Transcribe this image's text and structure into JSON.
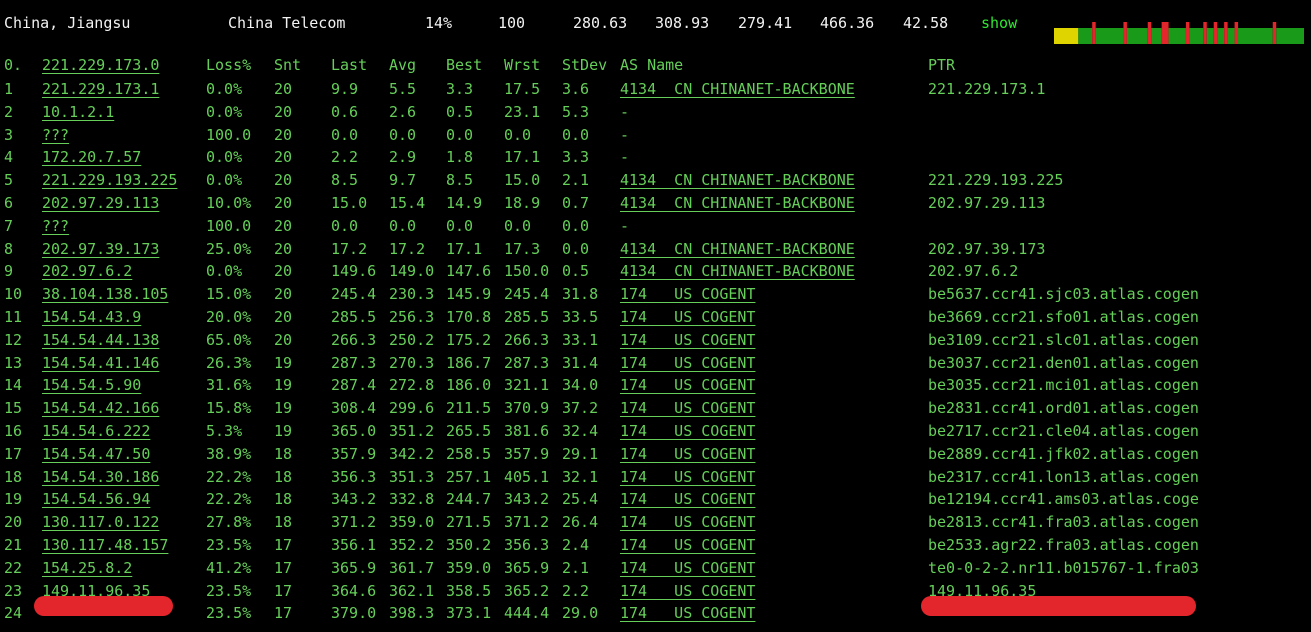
{
  "summary": {
    "location": "China, Jiangsu",
    "isp": "China Telecom",
    "loss": "14%",
    "sent": "100",
    "last": "280.63",
    "avg": "308.93",
    "best": "279.41",
    "worst": "466.36",
    "stdev": "42.58",
    "show_label": "show"
  },
  "colors": {
    "background": "#000000",
    "text": "#65cf59",
    "summary_text": "#f2f2f2",
    "show_link": "#2fe82f",
    "spark_good": "#199a19",
    "spark_warn": "#e0d400",
    "spark_bad": "#e3262b",
    "redaction": "#e3262b"
  },
  "spark_data": [
    {
      "level": "warn",
      "count": 7
    },
    {
      "level": "good",
      "count": 4
    },
    {
      "level": "bad",
      "count": 1
    },
    {
      "level": "good",
      "count": 8
    },
    {
      "level": "bad",
      "count": 1
    },
    {
      "level": "good",
      "count": 6
    },
    {
      "level": "bad",
      "count": 1
    },
    {
      "level": "good",
      "count": 3
    },
    {
      "level": "bad",
      "count": 2
    },
    {
      "level": "good",
      "count": 5
    },
    {
      "level": "bad",
      "count": 1
    },
    {
      "level": "good",
      "count": 4
    },
    {
      "level": "bad",
      "count": 1
    },
    {
      "level": "good",
      "count": 2
    },
    {
      "level": "bad",
      "count": 1
    },
    {
      "level": "good",
      "count": 2
    },
    {
      "level": "bad",
      "count": 1
    },
    {
      "level": "good",
      "count": 2
    },
    {
      "level": "bad",
      "count": 1
    },
    {
      "level": "good",
      "count": 10
    },
    {
      "level": "bad",
      "count": 1
    },
    {
      "level": "good",
      "count": 8
    }
  ],
  "header": {
    "idx": "0.",
    "host": "221.229.173.0",
    "loss": "Loss%",
    "snt": "Snt",
    "last": "Last",
    "avg": "Avg",
    "best": "Best",
    "wrst": "Wrst",
    "stdev": "StDev",
    "as_name": "AS Name",
    "ptr": "PTR"
  },
  "hops": [
    {
      "idx": "1",
      "host": "221.229.173.1",
      "loss": "0.0%",
      "snt": "20",
      "last": "9.9",
      "avg": "5.5",
      "best": "3.3",
      "wrst": "17.5",
      "stdev": "3.6",
      "as": "4134  CN CHINANET-BACKBONE",
      "ptr": "221.229.173.1"
    },
    {
      "idx": "2",
      "host": "10.1.2.1",
      "loss": "0.0%",
      "snt": "20",
      "last": "0.6",
      "avg": "2.6",
      "best": "0.5",
      "wrst": "23.1",
      "stdev": "5.3",
      "as": "-",
      "ptr": ""
    },
    {
      "idx": "3",
      "host": "???",
      "loss": "100.0",
      "snt": "20",
      "last": "0.0",
      "avg": "0.0",
      "best": "0.0",
      "wrst": "0.0",
      "stdev": "0.0",
      "as": "-",
      "ptr": ""
    },
    {
      "idx": "4",
      "host": "172.20.7.57",
      "loss": "0.0%",
      "snt": "20",
      "last": "2.2",
      "avg": "2.9",
      "best": "1.8",
      "wrst": "17.1",
      "stdev": "3.3",
      "as": "-",
      "ptr": ""
    },
    {
      "idx": "5",
      "host": "221.229.193.225",
      "loss": "0.0%",
      "snt": "20",
      "last": "8.5",
      "avg": "9.7",
      "best": "8.5",
      "wrst": "15.0",
      "stdev": "2.1",
      "as": "4134  CN CHINANET-BACKBONE",
      "ptr": "221.229.193.225"
    },
    {
      "idx": "6",
      "host": "202.97.29.113",
      "loss": "10.0%",
      "snt": "20",
      "last": "15.0",
      "avg": "15.4",
      "best": "14.9",
      "wrst": "18.9",
      "stdev": "0.7",
      "as": "4134  CN CHINANET-BACKBONE",
      "ptr": "202.97.29.113"
    },
    {
      "idx": "7",
      "host": "???",
      "loss": "100.0",
      "snt": "20",
      "last": "0.0",
      "avg": "0.0",
      "best": "0.0",
      "wrst": "0.0",
      "stdev": "0.0",
      "as": "-",
      "ptr": ""
    },
    {
      "idx": "8",
      "host": "202.97.39.173",
      "loss": "25.0%",
      "snt": "20",
      "last": "17.2",
      "avg": "17.2",
      "best": "17.1",
      "wrst": "17.3",
      "stdev": "0.0",
      "as": "4134  CN CHINANET-BACKBONE",
      "ptr": "202.97.39.173"
    },
    {
      "idx": "9",
      "host": "202.97.6.2",
      "loss": "0.0%",
      "snt": "20",
      "last": "149.6",
      "avg": "149.0",
      "best": "147.6",
      "wrst": "150.0",
      "stdev": "0.5",
      "as": "4134  CN CHINANET-BACKBONE",
      "ptr": "202.97.6.2"
    },
    {
      "idx": "10",
      "host": "38.104.138.105",
      "loss": "15.0%",
      "snt": "20",
      "last": "245.4",
      "avg": "230.3",
      "best": "145.9",
      "wrst": "245.4",
      "stdev": "31.8",
      "as": "174   US COGENT",
      "ptr": "be5637.ccr41.sjc03.atlas.cogen"
    },
    {
      "idx": "11",
      "host": "154.54.43.9",
      "loss": "20.0%",
      "snt": "20",
      "last": "285.5",
      "avg": "256.3",
      "best": "170.8",
      "wrst": "285.5",
      "stdev": "33.5",
      "as": "174   US COGENT",
      "ptr": "be3669.ccr21.sfo01.atlas.cogen"
    },
    {
      "idx": "12",
      "host": "154.54.44.138",
      "loss": "65.0%",
      "snt": "20",
      "last": "266.3",
      "avg": "250.2",
      "best": "175.2",
      "wrst": "266.3",
      "stdev": "33.1",
      "as": "174   US COGENT",
      "ptr": "be3109.ccr21.slc01.atlas.cogen"
    },
    {
      "idx": "13",
      "host": "154.54.41.146",
      "loss": "26.3%",
      "snt": "19",
      "last": "287.3",
      "avg": "270.3",
      "best": "186.7",
      "wrst": "287.3",
      "stdev": "31.4",
      "as": "174   US COGENT",
      "ptr": "be3037.ccr21.den01.atlas.cogen"
    },
    {
      "idx": "14",
      "host": "154.54.5.90",
      "loss": "31.6%",
      "snt": "19",
      "last": "287.4",
      "avg": "272.8",
      "best": "186.0",
      "wrst": "321.1",
      "stdev": "34.0",
      "as": "174   US COGENT",
      "ptr": "be3035.ccr21.mci01.atlas.cogen"
    },
    {
      "idx": "15",
      "host": "154.54.42.166",
      "loss": "15.8%",
      "snt": "19",
      "last": "308.4",
      "avg": "299.6",
      "best": "211.5",
      "wrst": "370.9",
      "stdev": "37.2",
      "as": "174   US COGENT",
      "ptr": "be2831.ccr41.ord01.atlas.cogen"
    },
    {
      "idx": "16",
      "host": "154.54.6.222",
      "loss": "5.3%",
      "snt": "19",
      "last": "365.0",
      "avg": "351.2",
      "best": "265.5",
      "wrst": "381.6",
      "stdev": "32.4",
      "as": "174   US COGENT",
      "ptr": "be2717.ccr21.cle04.atlas.cogen"
    },
    {
      "idx": "17",
      "host": "154.54.47.50",
      "loss": "38.9%",
      "snt": "18",
      "last": "357.9",
      "avg": "342.2",
      "best": "258.5",
      "wrst": "357.9",
      "stdev": "29.1",
      "as": "174   US COGENT",
      "ptr": "be2889.ccr41.jfk02.atlas.cogen"
    },
    {
      "idx": "18",
      "host": "154.54.30.186",
      "loss": "22.2%",
      "snt": "18",
      "last": "356.3",
      "avg": "351.3",
      "best": "257.1",
      "wrst": "405.1",
      "stdev": "32.1",
      "as": "174   US COGENT",
      "ptr": "be2317.ccr41.lon13.atlas.cogen"
    },
    {
      "idx": "19",
      "host": "154.54.56.94",
      "loss": "22.2%",
      "snt": "18",
      "last": "343.2",
      "avg": "332.8",
      "best": "244.7",
      "wrst": "343.2",
      "stdev": "25.4",
      "as": "174   US COGENT",
      "ptr": "be12194.ccr41.ams03.atlas.coge"
    },
    {
      "idx": "20",
      "host": "130.117.0.122",
      "loss": "27.8%",
      "snt": "18",
      "last": "371.2",
      "avg": "359.0",
      "best": "271.5",
      "wrst": "371.2",
      "stdev": "26.4",
      "as": "174   US COGENT",
      "ptr": "be2813.ccr41.fra03.atlas.cogen"
    },
    {
      "idx": "21",
      "host": "130.117.48.157",
      "loss": "23.5%",
      "snt": "17",
      "last": "356.1",
      "avg": "352.2",
      "best": "350.2",
      "wrst": "356.3",
      "stdev": "2.4",
      "as": "174   US COGENT",
      "ptr": "be2533.agr22.fra03.atlas.cogen"
    },
    {
      "idx": "22",
      "host": "154.25.8.2",
      "loss": "41.2%",
      "snt": "17",
      "last": "365.9",
      "avg": "361.7",
      "best": "359.0",
      "wrst": "365.9",
      "stdev": "2.1",
      "as": "174   US COGENT",
      "ptr": "te0-0-2-2.nr11.b015767-1.fra03"
    },
    {
      "idx": "23",
      "host": "149.11.96.35",
      "loss": "23.5%",
      "snt": "17",
      "last": "364.6",
      "avg": "362.1",
      "best": "358.5",
      "wrst": "365.2",
      "stdev": "2.2",
      "as": "174   US COGENT",
      "ptr": "149.11.96.35"
    },
    {
      "idx": "24",
      "host": "",
      "loss": "23.5%",
      "snt": "17",
      "last": "379.0",
      "avg": "398.3",
      "best": "373.1",
      "wrst": "444.4",
      "stdev": "29.0",
      "as": "174   US COGENT",
      "ptr": ""
    }
  ]
}
